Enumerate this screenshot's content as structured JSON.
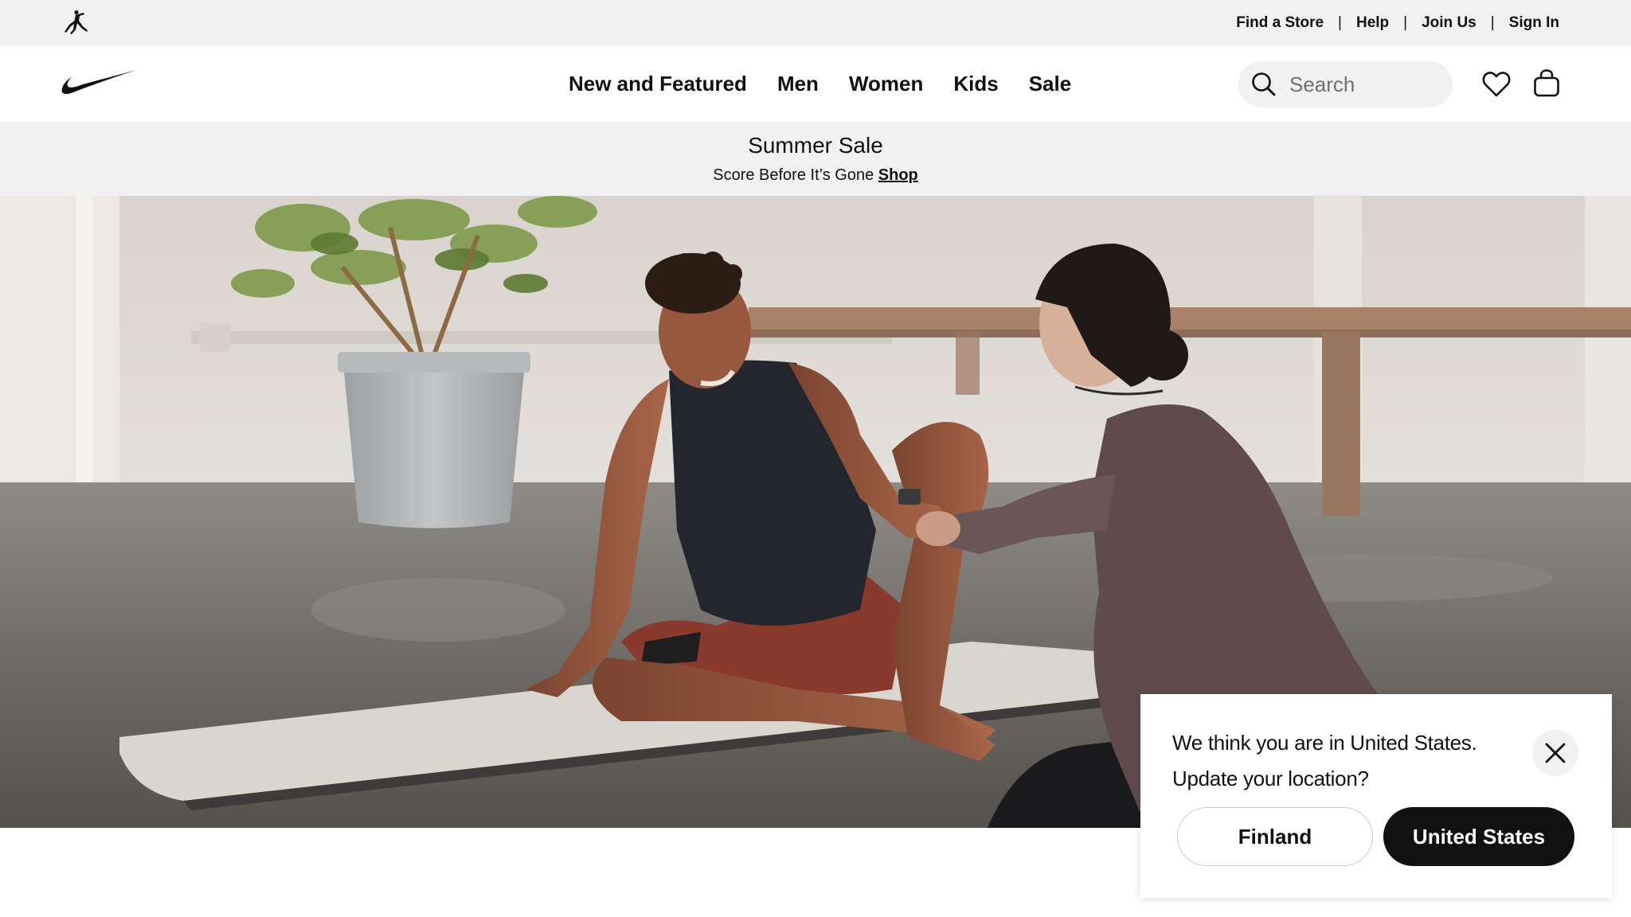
{
  "utility_bar": {
    "links": [
      "Find a Store",
      "Help",
      "Join Us",
      "Sign In"
    ],
    "separator": "|"
  },
  "nav": {
    "items": [
      "New and Featured",
      "Men",
      "Women",
      "Kids",
      "Sale"
    ],
    "search": {
      "placeholder": "Search"
    },
    "icons": [
      "jordan-jumpman-icon",
      "nike-swoosh-icon",
      "search-icon",
      "heart-icon",
      "bag-icon"
    ]
  },
  "promo": {
    "title": "Summer Sale",
    "subtitle": "Score Before It’s Gone",
    "link": "Shop"
  },
  "location_modal": {
    "line1": "We think you are in United States.",
    "line2": "Update your location?",
    "option_current": "Finland",
    "option_detected": "United States"
  },
  "colors": {
    "background": "#ffffff",
    "bar_gray": "#f1f1f1",
    "text": "#111111",
    "primary_button": "#111111"
  }
}
